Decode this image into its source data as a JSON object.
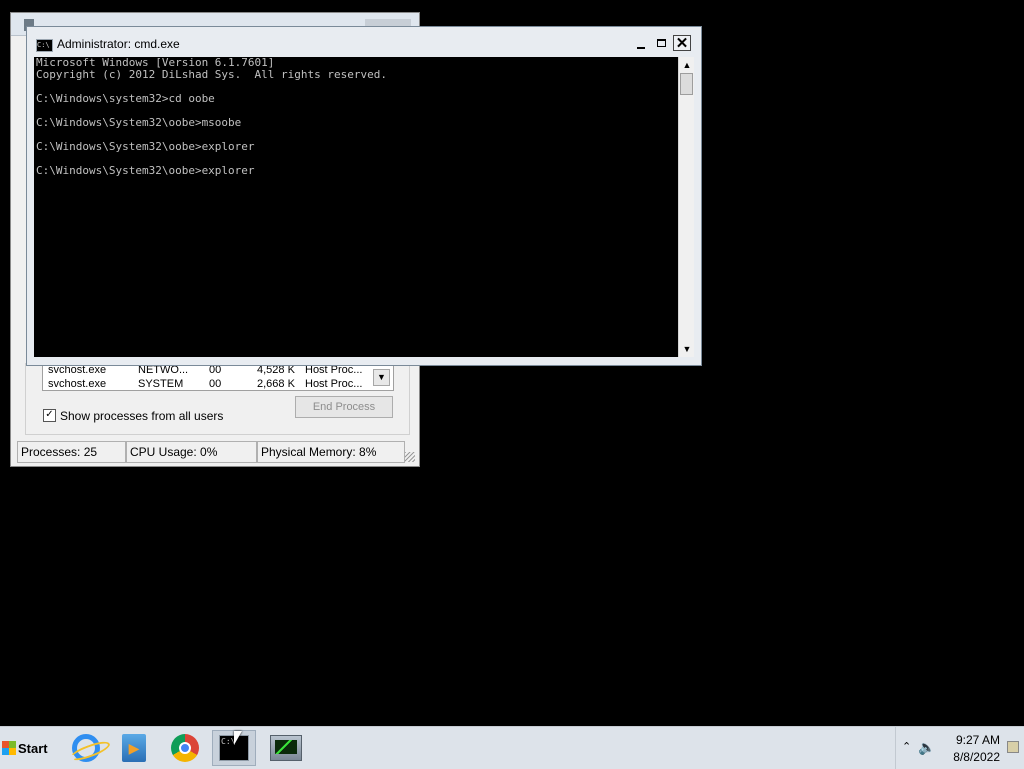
{
  "task_manager": {
    "rows": [
      {
        "name": "svchost.exe",
        "user": "NETWO...",
        "cpu": "00",
        "mem": "4,528 K",
        "desc": "Host Proc..."
      },
      {
        "name": "svchost.exe",
        "user": "SYSTEM",
        "cpu": "00",
        "mem": "2,668 K",
        "desc": "Host Proc..."
      }
    ],
    "show_all_users_label": "Show processes from all users",
    "show_all_users_checked": "✓",
    "end_process_label": "End Process",
    "status": {
      "processes": "Processes: 25",
      "cpu": "CPU Usage: 0%",
      "memory": "Physical Memory: 8%"
    }
  },
  "cmd": {
    "title": "Administrator: cmd.exe",
    "icon_text": "C:\\",
    "close_glyph": "✕",
    "lines": [
      "Microsoft Windows [Version 6.1.7601]",
      "Copyright (c) 2012 DiLshad Sys.  All rights reserved.",
      "",
      "C:\\Windows\\system32>cd oobe",
      "",
      "C:\\Windows\\System32\\oobe>msoobe",
      "",
      "C:\\Windows\\System32\\oobe>explorer",
      "",
      "C:\\Windows\\System32\\oobe>explorer"
    ]
  },
  "taskbar": {
    "start_label": "Start",
    "apps": [
      {
        "id": "ie",
        "icon": "internet-explorer-icon"
      },
      {
        "id": "media",
        "icon": "media-player-icon"
      },
      {
        "id": "chrome",
        "icon": "chrome-icon"
      },
      {
        "id": "cmd",
        "icon": "command-prompt-icon",
        "active": true
      },
      {
        "id": "taskmgr",
        "icon": "task-manager-icon"
      }
    ],
    "cmd_icon_text": "C:\\",
    "tray": {
      "arrow": "⌃",
      "volume": "🔈",
      "time": "9:27 AM",
      "date": "8/8/2022"
    }
  },
  "colors": {
    "console_bg": "#000000",
    "console_fg": "#c0c0c0",
    "desktop_bg": "#000000",
    "taskbar_bg": "#dde3ea"
  }
}
